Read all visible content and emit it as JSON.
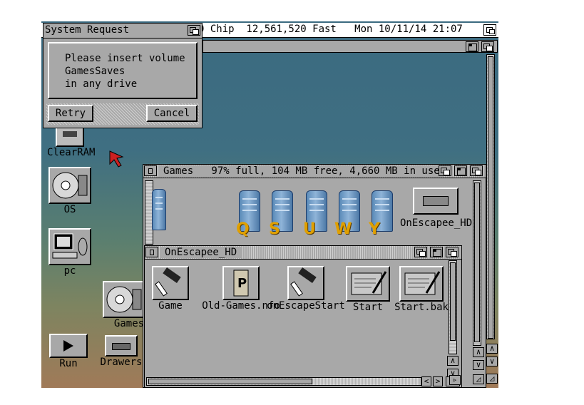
{
  "screen": {
    "title_bar_text": "0 Chip  12,561,520 Fast   Mon 10/11/14 21:07"
  },
  "dialog": {
    "title": "System Request",
    "message_lines": [
      "Please insert volume",
      "GamesSaves",
      "in any drive"
    ],
    "retry_label": "Retry",
    "cancel_label": "Cancel"
  },
  "desktop_icons": {
    "clearram": "ClearRAM",
    "os": "OS",
    "pc": "pc",
    "games": "Games",
    "run": "Run",
    "drawers": "Drawers"
  },
  "games_window": {
    "title": "Games   97% full, 104 MB free, 4,660 MB in use",
    "drawer_letters": [
      "Q",
      "S",
      "U",
      "W",
      "Y"
    ],
    "onescapee_hd_label": "OnEscapee_HD"
  },
  "onescapee_window": {
    "title": "OnEscapee_HD",
    "icons": [
      "Game",
      "Old-Games.nfo",
      "onEscapeStart",
      "Start",
      "Start.bak"
    ]
  },
  "colors": {
    "workbench_gray": "#a8a8a8",
    "desktop_top": "#3b6a80",
    "desktop_bottom": "#a07a58",
    "drawer_letter": "#e0a000"
  }
}
